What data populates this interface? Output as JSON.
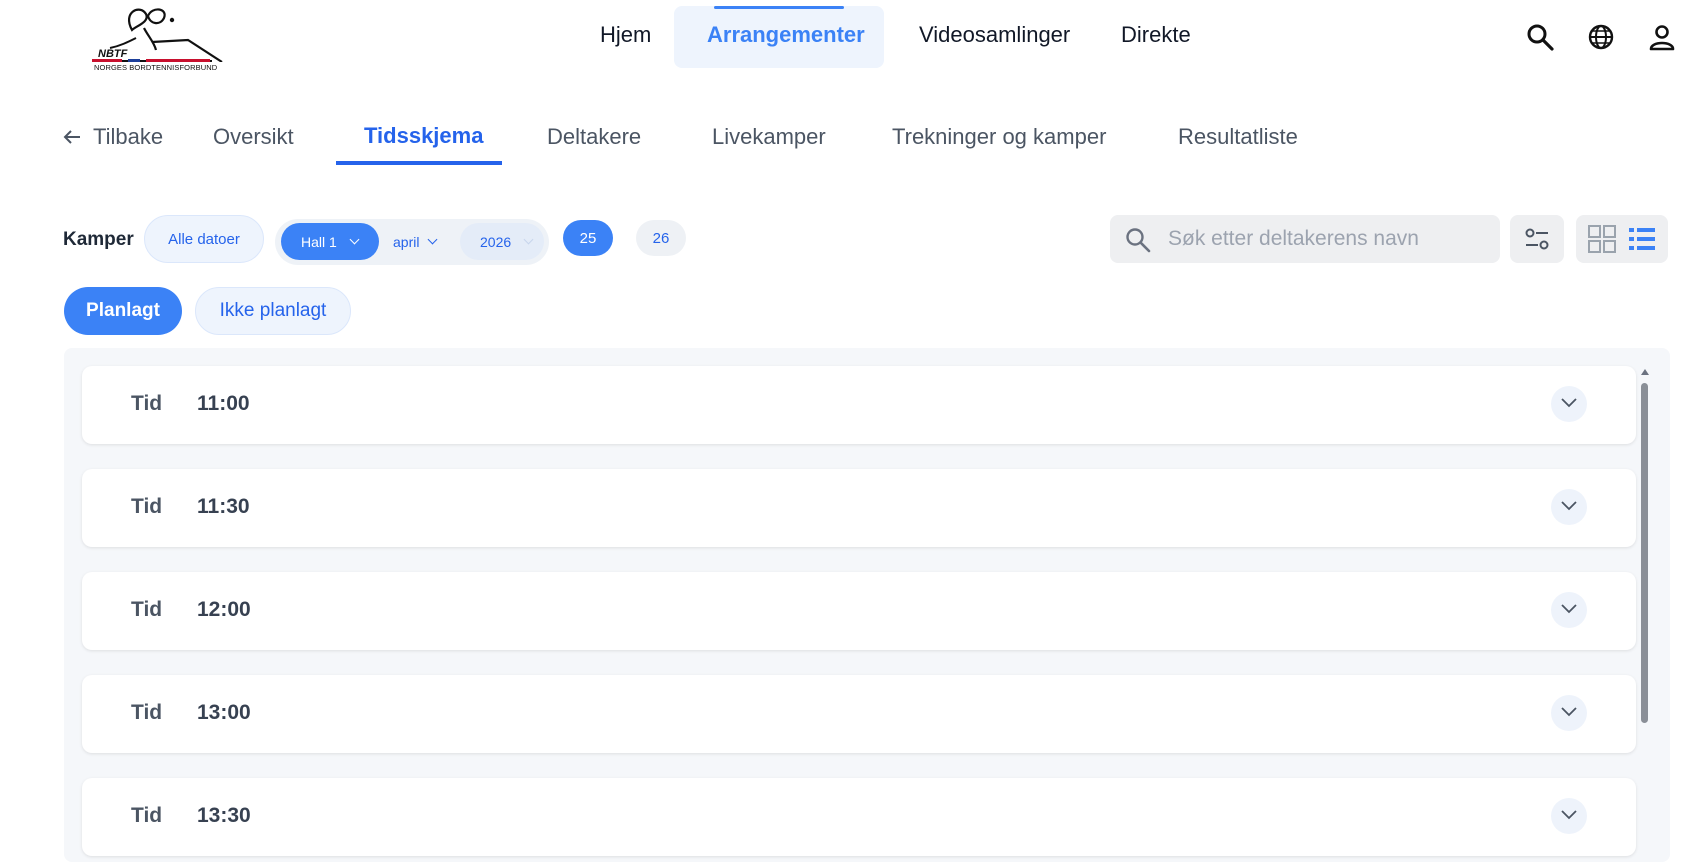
{
  "logo": {
    "abbr": "NBTF",
    "text": "NORGES BORDTENNISFORBUND"
  },
  "nav": {
    "items": [
      "Hjem",
      "Arrangementer",
      "Videosamlinger",
      "Direkte"
    ],
    "active": "Arrangementer"
  },
  "header_icons": [
    "search-icon",
    "globe-icon",
    "user-icon"
  ],
  "tabs": {
    "back_label": "Tilbake",
    "items": [
      "Oversikt",
      "Tidsskjema",
      "Deltakere",
      "Livekamper",
      "Trekninger og kamper",
      "Resultatliste"
    ],
    "active": "Tidsskjema"
  },
  "filters": {
    "label": "Kamper",
    "all_dates": "Alle datoer",
    "hall": "Hall 1",
    "month": "april",
    "year": "2026",
    "days": [
      "25",
      "26"
    ],
    "active_day": "25",
    "search_placeholder": "Søk etter deltakerens navn"
  },
  "status": {
    "planned": "Planlagt",
    "not_planned": "Ikke planlagt",
    "active": "Planlagt"
  },
  "schedule": {
    "row_label": "Tid",
    "times": [
      "11:00",
      "11:30",
      "12:00",
      "13:00",
      "13:30"
    ]
  },
  "colors": {
    "accent": "#3b82f6",
    "accent_dark": "#2563eb",
    "panel_bg": "#f5f7fa"
  }
}
